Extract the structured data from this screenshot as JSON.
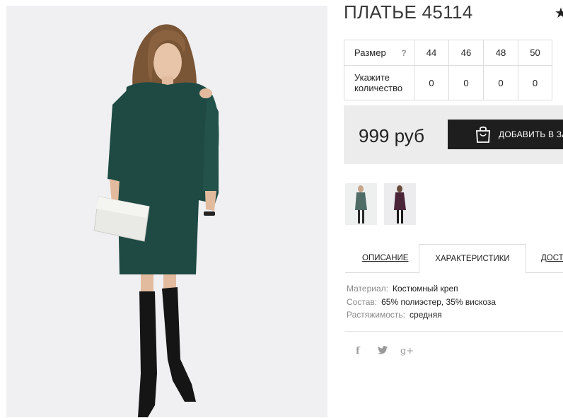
{
  "product": {
    "title": "ПЛАТЬЕ 45114"
  },
  "size_table": {
    "size_label": "Размер",
    "help_mark": "?",
    "sizes": [
      "44",
      "46",
      "48",
      "50"
    ],
    "quantity_label_line1": "Укажите",
    "quantity_label_line2": "количество",
    "quantities": [
      "0",
      "0",
      "0",
      "0"
    ]
  },
  "purchase": {
    "price": "999 руб",
    "add_to_cart_label": "ДОБАВИТЬ В ЗАКАЗ"
  },
  "tabs": {
    "description": "ОПИСАНИЕ",
    "specs": "ХАРАКТЕРИСТИКИ",
    "delivery": "ДОСТАВКА"
  },
  "specs": [
    {
      "key": "Материал:",
      "value": "Костюмный креп"
    },
    {
      "key": "Состав:",
      "value": "65% полиэстер, 35% вискоза"
    },
    {
      "key": "Растяжимость:",
      "value": "средняя"
    }
  ],
  "social": {
    "facebook": "f",
    "googleplus": "g+"
  },
  "icons": [
    "star-icon",
    "shopping-bag-icon",
    "facebook-icon",
    "twitter-icon",
    "google-plus-icon"
  ],
  "colors": {
    "dress_main": "#1f4a44",
    "thumb_alt_dress": "#4a2438",
    "button_bg": "#1e1e1e",
    "price_box_bg": "#ececec"
  }
}
